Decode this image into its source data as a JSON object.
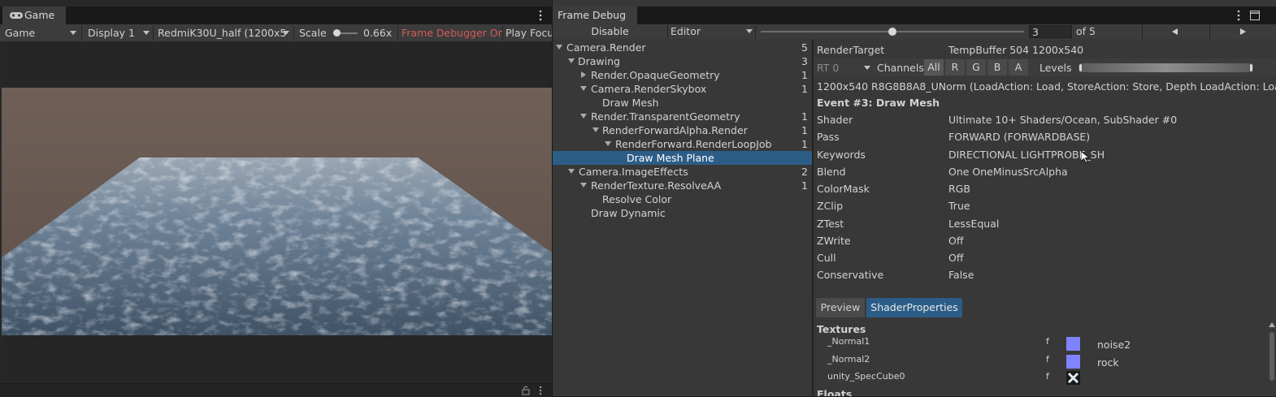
{
  "game": {
    "tab_label": "Game",
    "mode_select": "Game",
    "display_select": "Display 1",
    "resolution_select": "RedmiK30U_half (1200x5",
    "scale_label": "Scale",
    "scale_value": "0.66x",
    "frame_debugger_status": "Frame Debugger On",
    "play_focus": "Play Focu"
  },
  "frame_debug": {
    "tab_label": "Frame Debug",
    "disable_button": "Disable",
    "target_select": "Editor",
    "event_index": "3",
    "event_total": "of 5",
    "tree": [
      {
        "label": "Camera.Render",
        "count": "5"
      },
      {
        "label": "Drawing",
        "count": "3"
      },
      {
        "label": "Render.OpaqueGeometry",
        "count": "1"
      },
      {
        "label": "Camera.RenderSkybox",
        "count": "1"
      },
      {
        "label": "Draw Mesh",
        "count": ""
      },
      {
        "label": "Render.TransparentGeometry",
        "count": "1"
      },
      {
        "label": "RenderForwardAlpha.Render",
        "count": "1"
      },
      {
        "label": "RenderForward.RenderLoopJob",
        "count": "1"
      },
      {
        "label": "Draw Mesh Plane",
        "count": ""
      },
      {
        "label": "Camera.ImageEffects",
        "count": "2"
      },
      {
        "label": "RenderTexture.ResolveAA",
        "count": "1"
      },
      {
        "label": "Resolve Color",
        "count": ""
      },
      {
        "label": "Draw Dynamic",
        "count": ""
      }
    ],
    "render_target_label": "RenderTarget",
    "render_target_value": "TempBuffer 504 1200x540",
    "rt_select": "RT 0",
    "channels_label": "Channels",
    "channels": [
      "All",
      "R",
      "G",
      "B",
      "A"
    ],
    "levels_label": "Levels",
    "format_line": "1200x540 R8G8B8A8_UNorm (LoadAction: Load, StoreAction: Store, Depth LoadAction: Loa",
    "event_title": "Event #3: Draw Mesh",
    "properties": [
      {
        "name": "Shader",
        "value": "Ultimate 10+ Shaders/Ocean, SubShader #0"
      },
      {
        "name": "Pass",
        "value": "FORWARD (FORWARDBASE)"
      },
      {
        "name": "Keywords",
        "value": "DIRECTIONAL LIGHTPROBE_SH"
      },
      {
        "name": "Blend",
        "value": "One OneMinusSrcAlpha"
      },
      {
        "name": "ColorMask",
        "value": "RGB"
      },
      {
        "name": "ZClip",
        "value": "True"
      },
      {
        "name": "ZTest",
        "value": "LessEqual"
      },
      {
        "name": "ZWrite",
        "value": "Off"
      },
      {
        "name": "Cull",
        "value": "Off"
      },
      {
        "name": "Conservative",
        "value": "False"
      }
    ],
    "tabs": [
      "Preview",
      "ShaderProperties"
    ],
    "textures_label": "Textures",
    "textures": [
      {
        "name": "_Normal1",
        "flag": "f",
        "texture": "noise2"
      },
      {
        "name": "_Normal2",
        "flag": "f",
        "texture": "rock"
      },
      {
        "name": "unity_SpecCube0",
        "flag": "f",
        "texture": ""
      }
    ],
    "floats_label": "Floats"
  }
}
